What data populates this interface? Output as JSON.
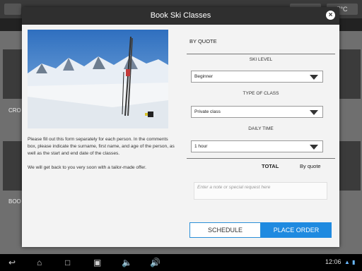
{
  "modal": {
    "title": "Book Ski Classes",
    "description_1": "Please fill out this form separately for each person. In the comments box, please indicate the surname, first name, and age of the person, as well as the start and end date of the classes.",
    "description_2": "We will get back to you very soon with a tailor-made offer.",
    "pricing_mode": "BY QUOTE",
    "ski_level": {
      "label": "SKI LEVEL",
      "value": "Beginner"
    },
    "class_type": {
      "label": "TYPE OF CLASS",
      "value": "Private class"
    },
    "daily_time": {
      "label": "DAILY TIME",
      "value": "1 hour"
    },
    "total": {
      "label": "TOTAL",
      "value": "By quote"
    },
    "note_placeholder": "Enter a note or special request here",
    "schedule_button": "SCHEDULE",
    "place_order_button": "PLACE ORDER"
  },
  "background": {
    "weather": "7°C",
    "tile_label_1": "CRO",
    "tile_label_2": "BOO"
  },
  "navbar": {
    "time": "12:06",
    "icons": [
      "back-icon",
      "home-icon",
      "recent-apps-icon",
      "screenshot-icon",
      "volume-down-icon",
      "volume-up-icon"
    ]
  },
  "colors": {
    "modal_header": "#2f2f2f",
    "accent_blue": "#1f8ae0"
  }
}
